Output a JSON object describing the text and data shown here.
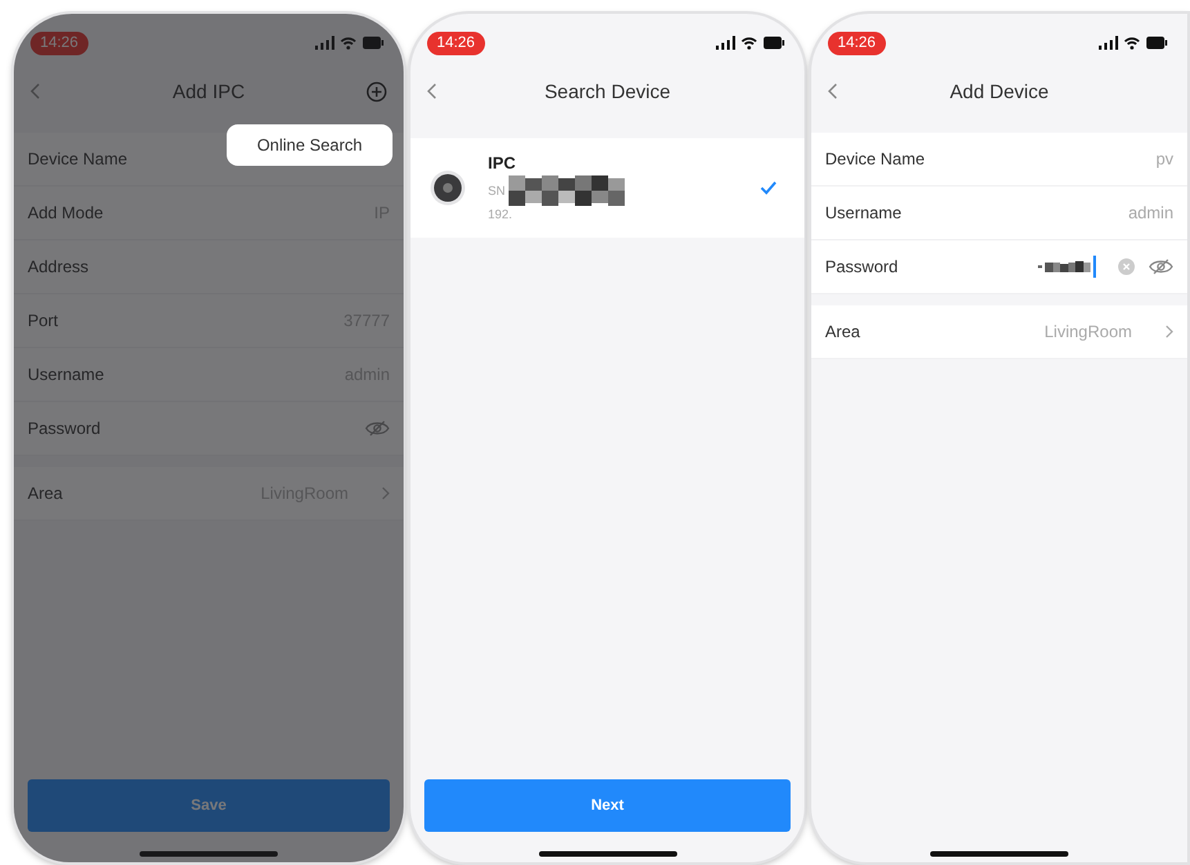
{
  "screens": [
    {
      "kind": "form",
      "dimmed": true,
      "time": "14:26",
      "title": "Add IPC",
      "add_icon": true,
      "popup": {
        "label": "Online Search"
      },
      "groups": [
        [
          {
            "label": "Device Name"
          },
          {
            "label": "Add Mode",
            "value": "IP"
          },
          {
            "label": "Address"
          },
          {
            "label": "Port",
            "value": "37777"
          },
          {
            "label": "Username",
            "value": "admin"
          },
          {
            "label": "Password",
            "eye": true
          }
        ],
        [
          {
            "label": "Area",
            "value": "LivingRoom",
            "chevron": true
          }
        ]
      ],
      "button": {
        "label": "Save"
      }
    },
    {
      "kind": "search",
      "dimmed": false,
      "time": "14:26",
      "title": "Search Device",
      "devices": [
        {
          "name": "IPC",
          "sn_label": "SN",
          "ip_prefix": "192.",
          "selected": true
        }
      ],
      "button": {
        "label": "Next"
      }
    },
    {
      "kind": "form",
      "dimmed": false,
      "time": "14:26",
      "title": "Add Device",
      "groups": [
        [
          {
            "label": "Device Name",
            "value": "pv"
          },
          {
            "label": "Username",
            "value": "admin"
          },
          {
            "label": "Password",
            "obscured": true,
            "clear": true,
            "eye": true
          }
        ],
        [
          {
            "label": "Area",
            "value": "LivingRoom",
            "chevron": true
          }
        ]
      ]
    }
  ]
}
